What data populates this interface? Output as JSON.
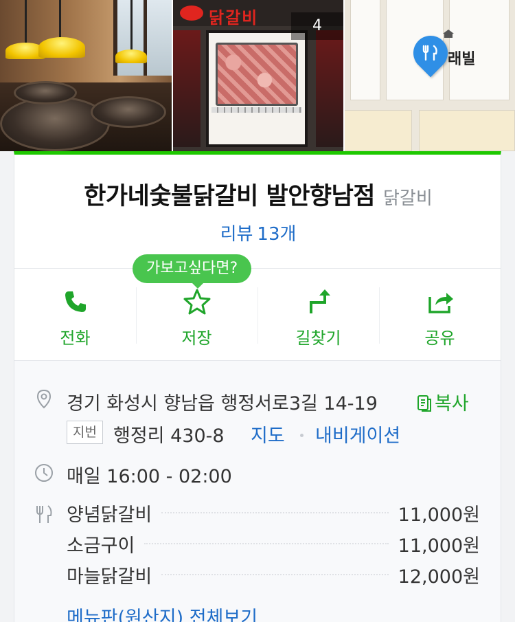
{
  "photos": {
    "count_badge": "4",
    "map_label": "래빌",
    "sign_text": "닭갈비"
  },
  "place": {
    "name": "한가네숯불닭갈비 발안향남점",
    "category": "닭갈비",
    "review_label": "리뷰",
    "review_count": "13개"
  },
  "tooltip": "가보고싶다면?",
  "actions": [
    {
      "label": "전화",
      "icon": "phone-icon"
    },
    {
      "label": "저장",
      "icon": "star-icon"
    },
    {
      "label": "길찾기",
      "icon": "directions-icon"
    },
    {
      "label": "공유",
      "icon": "share-icon"
    }
  ],
  "info": {
    "address": "경기 화성시 향남읍 행정서로3길 14-19",
    "copy_label": "복사",
    "jibun_badge": "지번",
    "jibun_address": "행정리 430-8",
    "map_link": "지도",
    "navi_link": "내비게이션",
    "hours": "매일 16:00 - 02:00",
    "menu": [
      {
        "name": "양념닭갈비",
        "price": "11,000원"
      },
      {
        "name": "소금구이",
        "price": "11,000원"
      },
      {
        "name": "마늘닭갈비",
        "price": "12,000원"
      }
    ],
    "menu_all": "메뉴판(원산지) 전체보기"
  },
  "colors": {
    "accent_green": "#1ec800",
    "link_blue": "#1e6cc8",
    "action_green": "#1fa52a",
    "pin_blue": "#2f8fe6"
  }
}
